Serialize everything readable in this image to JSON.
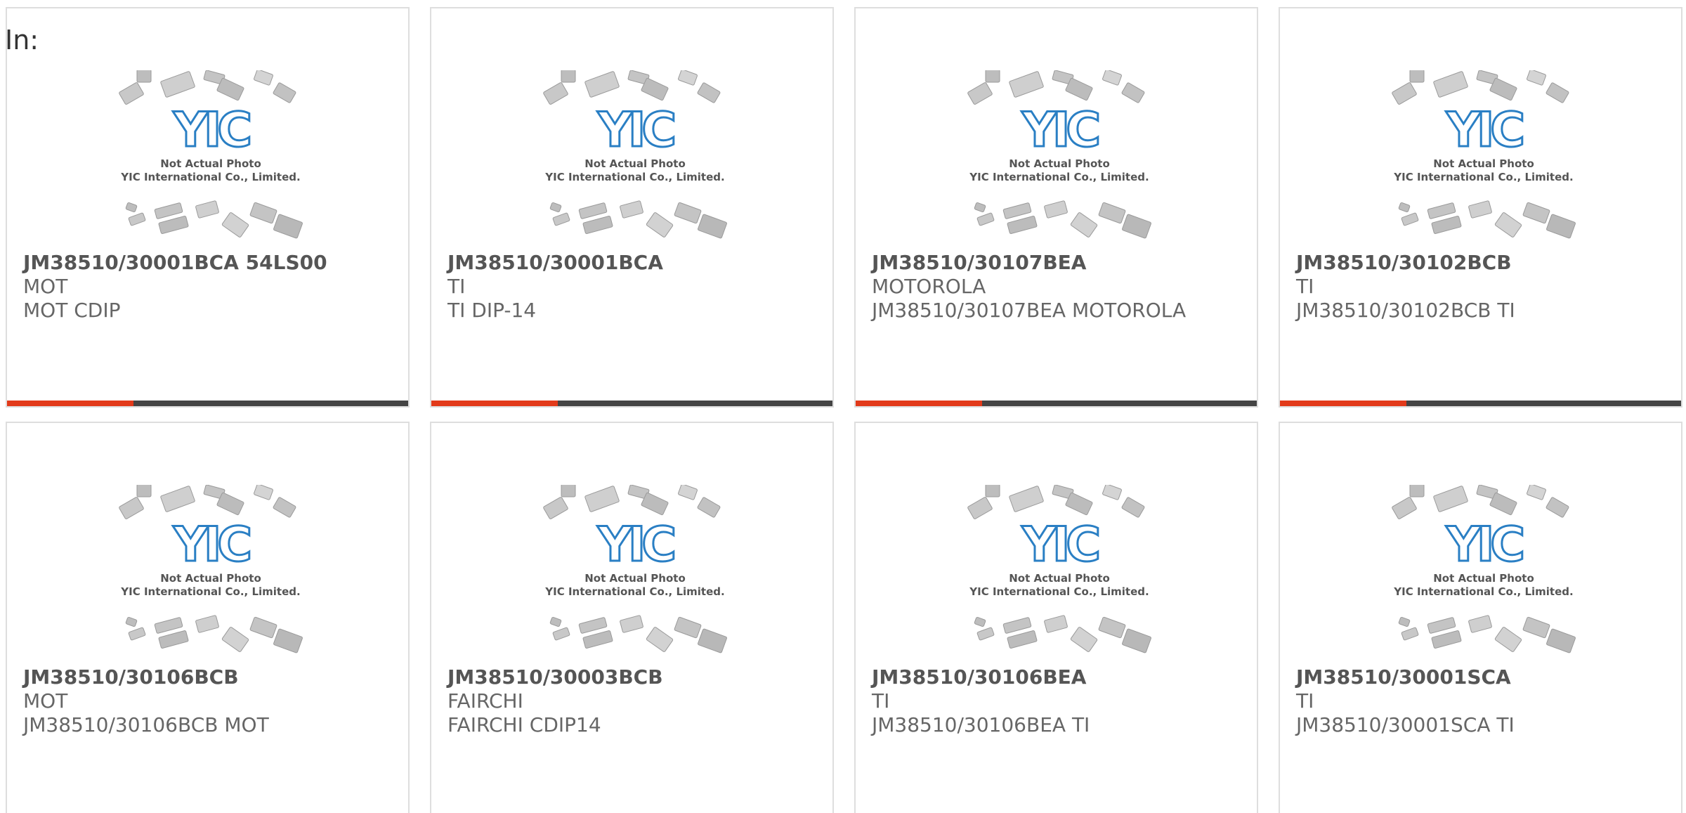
{
  "header": {
    "label": "In:"
  },
  "placeholder_image": {
    "line1": "Not Actual Photo",
    "line2": "YIC International Co., Limited.",
    "logo_text": "YIC"
  },
  "colors": {
    "accent": "#e23a1a",
    "bar": "#444444",
    "logo_blue": "#2a7fc4",
    "border": "#dedede"
  },
  "products": [
    {
      "part": "JM38510/30001BCA 54LS00",
      "brand": "MOT",
      "desc": "MOT CDIP"
    },
    {
      "part": "JM38510/30001BCA",
      "brand": "TI",
      "desc": "TI DIP-14"
    },
    {
      "part": "JM38510/30107BEA",
      "brand": "MOTOROLA",
      "desc": "JM38510/30107BEA MOTOROLA"
    },
    {
      "part": "JM38510/30102BCB",
      "brand": "TI",
      "desc": "JM38510/30102BCB TI"
    },
    {
      "part": "JM38510/30106BCB",
      "brand": "MOT",
      "desc": "JM38510/30106BCB MOT"
    },
    {
      "part": "JM38510/30003BCB",
      "brand": "FAIRCHI",
      "desc": "FAIRCHI CDIP14"
    },
    {
      "part": "JM38510/30106BEA",
      "brand": "TI",
      "desc": "JM38510/30106BEA TI"
    },
    {
      "part": "JM38510/30001SCA",
      "brand": "TI",
      "desc": "JM38510/30001SCA TI"
    }
  ]
}
